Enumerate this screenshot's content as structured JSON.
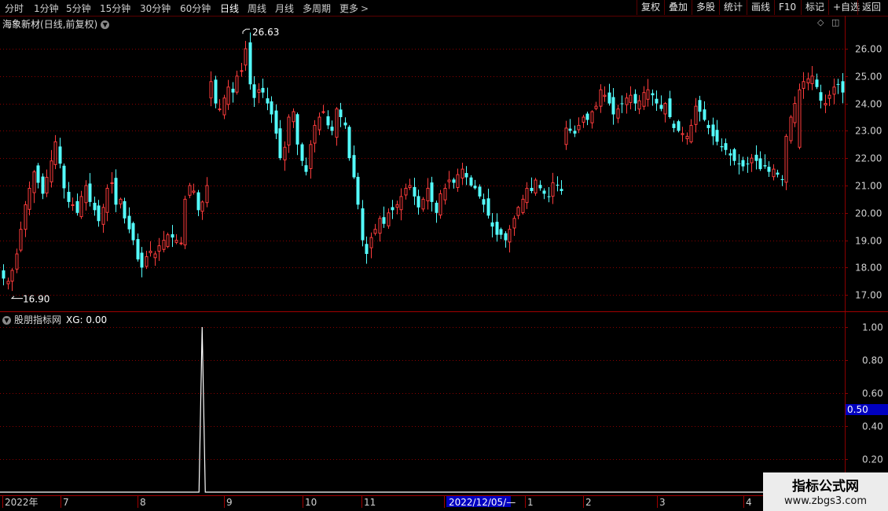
{
  "toolbar": {
    "timeframes": [
      "分时",
      "1分钟",
      "5分钟",
      "15分钟",
      "30分钟",
      "60分钟",
      "日线",
      "周线",
      "月线",
      "多周期",
      "更多"
    ],
    "active": "日线",
    "tools": [
      "复权",
      "叠加",
      "多股",
      "统计",
      "画线",
      "F10",
      "标记",
      "+自选",
      "返回"
    ]
  },
  "main_chart": {
    "stock_name": "海象新材",
    "mode": "(日线,前复权)",
    "high_label": "26.63",
    "low_label": "16.90"
  },
  "indicator": {
    "name": "股朋指标网",
    "xg_label": "XG: 0.00",
    "cursor_value": "0.50"
  },
  "date_axis": {
    "cursor_date": "2022/12/05/—"
  },
  "watermark": {
    "line1": "指标公式网",
    "line2": "www.zbgs3.com"
  },
  "colors": {
    "up": "#ff3c3c",
    "down": "#54ffff",
    "grid": "#8a0000",
    "axis_text": "#d0d0d0"
  },
  "chart_data": [
    {
      "type": "candlestick",
      "title": "海象新材(日线,前复权)",
      "y_ticks": [
        "26.00",
        "25.00",
        "24.00",
        "23.00",
        "22.00",
        "21.00",
        "20.00",
        "19.00",
        "18.00",
        "17.00"
      ],
      "ylim": [
        16.5,
        26.8
      ],
      "x_ticks": [
        "2022年",
        "7",
        "8",
        "9",
        "10",
        "11",
        "1",
        "2022/12/05/—",
        "1",
        "2",
        "3",
        "4"
      ],
      "grid": true,
      "annotations": [
        {
          "label": "26.63",
          "value": 26.63
        },
        {
          "label": "16.90",
          "value": 16.9
        }
      ],
      "closes": [
        17.6,
        17.5,
        17.9,
        18.5,
        19.4,
        20.3,
        20.9,
        21.5,
        21.1,
        20.7,
        21.3,
        21.9,
        22.6,
        21.8,
        20.9,
        20.4,
        20.3,
        20.0,
        20.6,
        21.0,
        20.4,
        20.1,
        19.7,
        20.2,
        20.9,
        21.1,
        20.3,
        20.5,
        19.8,
        19.4,
        19.0,
        18.3,
        18.0,
        18.4,
        18.6,
        18.5,
        18.8,
        19.0,
        19.2,
        19.1,
        19.0,
        18.9,
        20.5,
        21.0,
        20.8,
        20.1,
        20.4,
        21.0,
        24.8,
        24.0,
        23.8,
        24.2,
        24.6,
        24.4,
        25.0,
        25.2,
        26.0,
        24.7,
        24.2,
        24.5,
        24.4,
        24.0,
        23.6,
        22.9,
        22.0,
        22.4,
        23.5,
        23.7,
        22.5,
        21.9,
        21.5,
        22.5,
        23.2,
        23.5,
        23.7,
        23.2,
        23.0,
        23.8,
        23.5,
        23.2,
        22.0,
        21.3,
        20.3,
        19.0,
        18.5,
        19.1,
        19.4,
        19.8,
        19.6,
        20.0,
        20.1,
        20.3,
        20.6,
        20.9,
        21.0,
        20.6,
        20.2,
        20.5,
        20.9,
        20.4,
        20.0,
        20.7,
        20.9,
        21.2,
        21.1,
        21.4,
        21.6,
        21.3,
        21.0,
        20.9,
        20.6,
        20.3,
        19.9,
        19.5,
        19.2,
        19.2,
        19.0,
        19.4,
        19.8,
        20.2,
        20.5,
        20.9,
        20.8,
        21.2,
        20.9,
        20.7,
        20.6,
        21.1,
        21.0,
        20.8,
        23.1,
        23.0,
        22.9,
        23.2,
        23.5,
        23.4,
        23.7,
        23.9,
        24.5,
        24.3,
        24.0,
        23.6,
        23.8,
        24.0,
        24.2,
        24.3,
        24.0,
        24.1,
        24.4,
        24.5,
        24.3,
        24.0,
        23.8,
        24.0,
        23.5,
        23.1,
        23.0,
        22.9,
        22.8,
        23.2,
        23.9,
        23.7,
        23.4,
        23.1,
        22.8,
        22.6,
        22.4,
        22.3,
        22.1,
        21.9,
        21.8,
        21.7,
        21.8,
        22.0,
        21.9,
        21.6,
        21.7,
        21.5,
        21.6,
        21.4,
        21.2,
        22.8,
        23.5,
        24.0,
        24.5,
        24.8,
        24.9,
        25.0,
        24.6,
        24.1,
        24.0,
        24.3,
        24.6,
        24.7,
        24.4
      ]
    },
    {
      "type": "line",
      "title": "股朋指标网",
      "y_ticks": [
        "1.00",
        "0.80",
        "0.60",
        "0.40",
        "0.20"
      ],
      "ylim": [
        -0.05,
        1.1
      ],
      "series": [
        {
          "name": "XG",
          "spike_at_index": 46,
          "spike_value": 1.0,
          "base_value": 0.0
        }
      ]
    }
  ]
}
